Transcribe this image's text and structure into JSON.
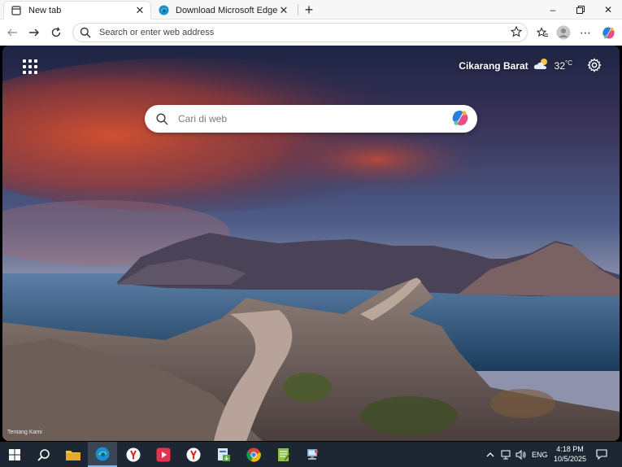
{
  "tabs": [
    {
      "title": "New tab",
      "active": true
    },
    {
      "title": "Download Microsoft Edge: Windo",
      "active": false
    }
  ],
  "window_controls": {
    "minimize": "–",
    "restore": "❐",
    "close": "✕"
  },
  "address_bar": {
    "placeholder": "Search or enter web address",
    "value": ""
  },
  "new_tab_page": {
    "weather": {
      "location": "Cikarang Barat",
      "temperature": "32",
      "unit": "°C",
      "icon": "partly-cloudy-icon"
    },
    "search": {
      "placeholder": "Cari di web"
    },
    "footer_link": "Tentang Kami"
  },
  "taskbar": {
    "apps": [
      "start",
      "search",
      "file-explorer",
      "edge",
      "yandex",
      "video-player",
      "yandex",
      "installer",
      "chrome",
      "notepad",
      "network-tool"
    ],
    "tray": {
      "language": "ENG"
    },
    "clock": {
      "time": "4:18 PM",
      "date": "10/5/2025"
    }
  },
  "colors": {
    "accent": "#0078d4",
    "taskbar": "#1c2733",
    "tab_strip": "#f7f7f7"
  }
}
